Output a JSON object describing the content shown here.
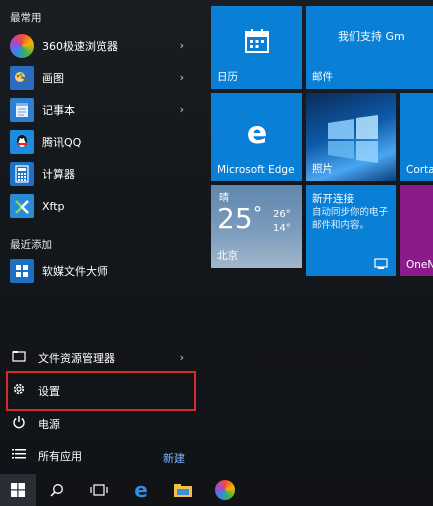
{
  "left": {
    "section_frequent": "最常用",
    "section_recent": "最近添加",
    "apps": [
      {
        "label": "360极速浏览器",
        "icon": "360-browser-icon"
      },
      {
        "label": "画图",
        "icon": "paint-icon"
      },
      {
        "label": "记事本",
        "icon": "notepad-icon"
      },
      {
        "label": "腾讯QQ",
        "icon": "qq-icon"
      },
      {
        "label": "计算器",
        "icon": "calculator-icon"
      },
      {
        "label": "Xftp",
        "icon": "xftp-icon"
      }
    ],
    "recent_app": {
      "label": "软媒文件大师",
      "icon": "file-master-icon"
    },
    "file_explorer": "文件资源管理器",
    "settings": "设置",
    "power": "电源",
    "all_apps": "所有应用",
    "new_link": "新建"
  },
  "tiles": {
    "calendar": "日历",
    "mail_header": "我们支持 Gm",
    "mail": "邮件",
    "edge": "Microsoft Edge",
    "photos": "照片",
    "cortana": "Corta",
    "weather": {
      "condition": "晴",
      "temp": "25",
      "unit": "°",
      "high": "26°",
      "low": "14°",
      "city": "北京"
    },
    "connect_title": "新开连接",
    "connect_desc": "自动同步你的电子邮件和内容。",
    "onenote": "OneN"
  },
  "colors": {
    "tile_blue": "#0a7fd6",
    "onenote_purple": "#8b1a8b",
    "highlight_red": "#d62a2a"
  }
}
